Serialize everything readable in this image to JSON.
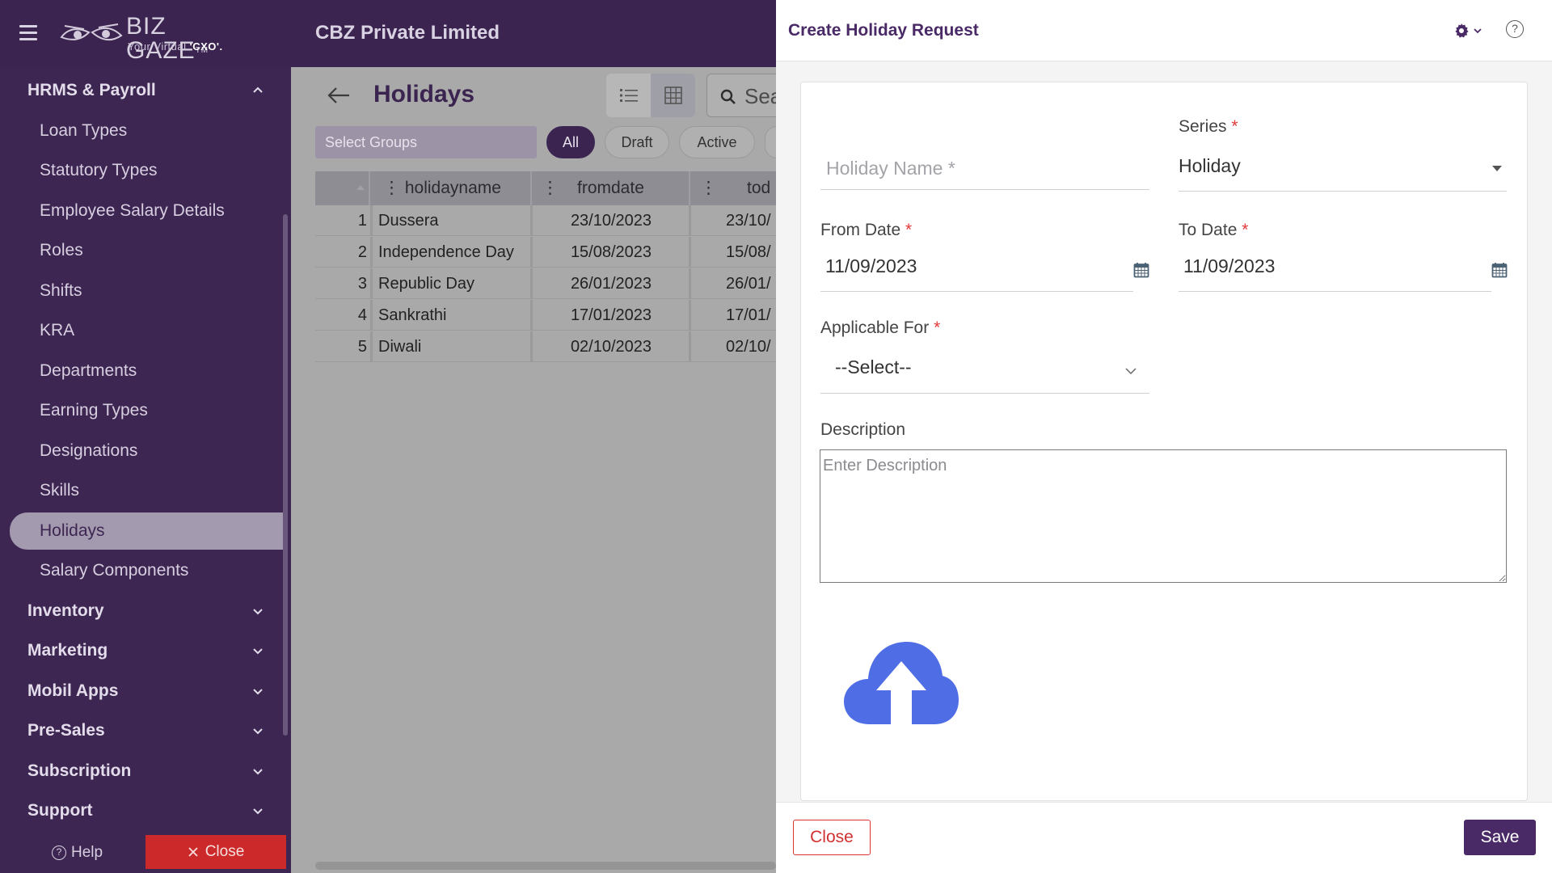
{
  "header": {
    "logo_text": "BIZ GAZE",
    "logo_tm": "TM",
    "logo_sub_prefix": "Your Virtual ",
    "logo_sub_bold": "'CXO'.",
    "company": "CBZ Private Limited"
  },
  "sidebar": {
    "section": "HRMS & Payroll",
    "items": [
      {
        "label": "Loan Types"
      },
      {
        "label": "Statutory Types"
      },
      {
        "label": "Employee Salary Details"
      },
      {
        "label": "Roles"
      },
      {
        "label": "Shifts"
      },
      {
        "label": "KRA"
      },
      {
        "label": "Departments"
      },
      {
        "label": "Earning Types"
      },
      {
        "label": "Designations"
      },
      {
        "label": "Skills"
      },
      {
        "label": "Holidays"
      },
      {
        "label": "Salary Components"
      }
    ],
    "groups": [
      {
        "label": "Inventory"
      },
      {
        "label": "Marketing"
      },
      {
        "label": "Mobil Apps"
      },
      {
        "label": "Pre-Sales"
      },
      {
        "label": "Subscription"
      },
      {
        "label": "Support"
      }
    ],
    "help_label": "Help",
    "close_label": "Close"
  },
  "main": {
    "title": "Holidays",
    "search_text": "Sea",
    "select_groups": "Select Groups",
    "filters": [
      "All",
      "Draft",
      "Active"
    ],
    "columns": [
      "holidayname",
      "fromdate",
      "tod"
    ],
    "rows": [
      {
        "n": "1",
        "name": "Dussera",
        "from": "23/10/2023",
        "to": "23/10/"
      },
      {
        "n": "2",
        "name": "Independence Day",
        "from": "15/08/2023",
        "to": "15/08/"
      },
      {
        "n": "3",
        "name": "Republic Day",
        "from": "26/01/2023",
        "to": "26/01/"
      },
      {
        "n": "4",
        "name": "Sankrathi",
        "from": "17/01/2023",
        "to": "17/01/"
      },
      {
        "n": "5",
        "name": "Diwali",
        "from": "02/10/2023",
        "to": "02/10/"
      }
    ]
  },
  "drawer": {
    "title": "Create Holiday Request",
    "holiday_name_placeholder": "Holiday Name *",
    "series_label": "Series",
    "series_value": "Holiday",
    "from_date_label": "From Date",
    "from_date_value": "11/09/2023",
    "to_date_label": "To Date",
    "to_date_value": "11/09/2023",
    "applicable_label": "Applicable For",
    "applicable_value": "--Select--",
    "description_label": "Description",
    "description_placeholder": "Enter Description",
    "required_mark": "*",
    "close_label": "Close",
    "save_label": "Save"
  },
  "colors": {
    "brand": "#3b2550",
    "accent": "#4a2a66",
    "danger": "#d23030",
    "upload_blue": "#4f6ee6"
  }
}
